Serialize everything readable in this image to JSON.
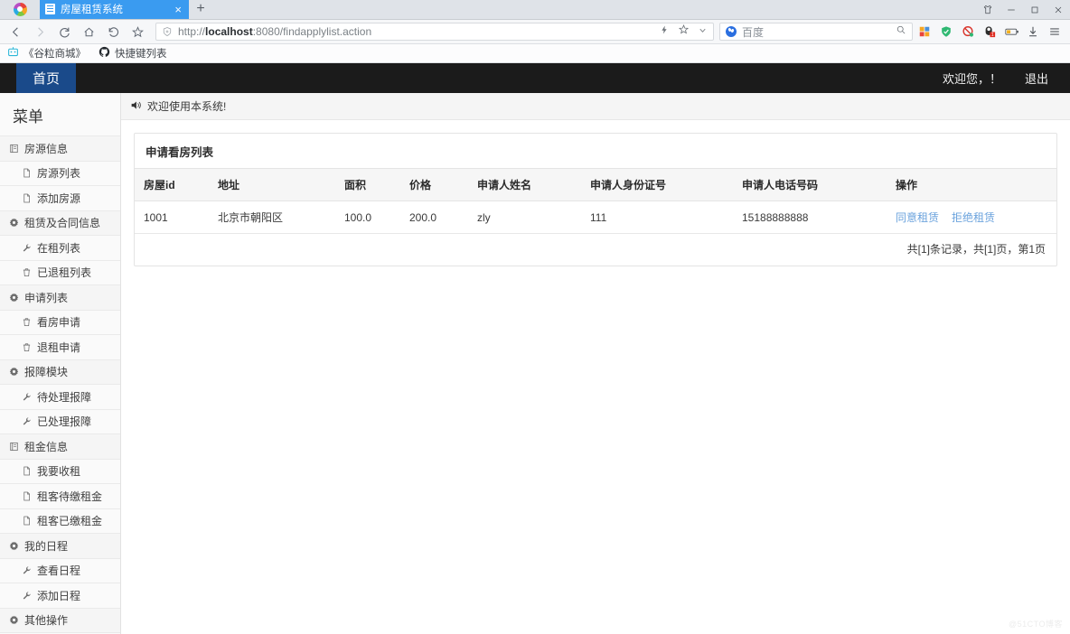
{
  "browser": {
    "tab": {
      "title": "房屋租赁系统",
      "favicon": "page-icon",
      "close": "×"
    },
    "newtab_label": "+",
    "window_controls": [
      "skin-icon",
      "minimize-icon",
      "maximize-icon",
      "close-icon"
    ],
    "nav": {
      "back": "‹",
      "forward": "›",
      "reload": "⟳",
      "home": "⌂",
      "history": "↺",
      "favorite": "☆"
    },
    "url": {
      "scheme": "http://",
      "host": "localhost",
      "rest": ":8080/findapplylist.action",
      "full": "http://localhost:8080/findapplylist.action"
    },
    "url_right_icons": [
      "lightning-icon",
      "star-icon",
      "chevron-down-icon"
    ],
    "search": {
      "engine": "百度",
      "engine_icon": "baidu-icon",
      "placeholder": "百度",
      "value": "",
      "search_icon": "search-icon"
    },
    "extensions": [
      "apps-grid-icon",
      "shield-icon",
      "adblock-icon",
      "mouse-gesture-icon",
      "battery-icon",
      "download-icon",
      "menu-icon"
    ],
    "bookmarks": [
      {
        "label": "《谷粒商城》",
        "icon": "bookmark-site-icon"
      },
      {
        "label": "快捷键列表",
        "icon": "github-icon"
      }
    ]
  },
  "app": {
    "home_tab": "首页",
    "welcome_user": "欢迎您，！",
    "logout": "退出",
    "notice": "欢迎使用本系统!",
    "notice_icon": "speaker-icon",
    "sidebar": {
      "title": "菜单",
      "items": [
        {
          "label": "房源信息",
          "type": "group",
          "icon": "book-icon"
        },
        {
          "label": "房源列表",
          "type": "item",
          "icon": "file-icon"
        },
        {
          "label": "添加房源",
          "type": "item",
          "icon": "file-icon"
        },
        {
          "label": "租赁及合同信息",
          "type": "group",
          "icon": "gear-icon"
        },
        {
          "label": "在租列表",
          "type": "item",
          "icon": "wrench-icon"
        },
        {
          "label": "已退租列表",
          "type": "item",
          "icon": "trash-icon"
        },
        {
          "label": "申请列表",
          "type": "group",
          "icon": "gear-icon"
        },
        {
          "label": "看房申请",
          "type": "item",
          "icon": "trash-icon"
        },
        {
          "label": "退租申请",
          "type": "item",
          "icon": "trash-icon"
        },
        {
          "label": "报障模块",
          "type": "group",
          "icon": "gear-icon"
        },
        {
          "label": "待处理报障",
          "type": "item",
          "icon": "wrench-icon"
        },
        {
          "label": "已处理报障",
          "type": "item",
          "icon": "wrench-icon"
        },
        {
          "label": "租金信息",
          "type": "group",
          "icon": "book-icon"
        },
        {
          "label": "我要收租",
          "type": "item",
          "icon": "file-icon"
        },
        {
          "label": "租客待缴租金",
          "type": "item",
          "icon": "file-icon"
        },
        {
          "label": "租客已缴租金",
          "type": "item",
          "icon": "file-icon"
        },
        {
          "label": "我的日程",
          "type": "group",
          "icon": "gear-icon"
        },
        {
          "label": "查看日程",
          "type": "item",
          "icon": "wrench-icon"
        },
        {
          "label": "添加日程",
          "type": "item",
          "icon": "wrench-icon"
        },
        {
          "label": "其他操作",
          "type": "group",
          "icon": "gear-icon"
        }
      ]
    },
    "panel": {
      "title": "申请看房列表",
      "columns": [
        "房屋id",
        "地址",
        "面积",
        "价格",
        "申请人姓名",
        "申请人身份证号",
        "申请人电话号码",
        "操作"
      ],
      "rows": [
        {
          "house_id": "1001",
          "address": "北京市朝阳区",
          "area": "100.0",
          "price": "200.0",
          "applicant_name": "zly",
          "applicant_id": "111",
          "applicant_phone": "15188888888",
          "action_accept": "同意租赁",
          "action_reject": "拒绝租赁"
        }
      ],
      "pager": "共[1]条记录，共[1]页，第1页"
    },
    "watermark": "@51CTO博客"
  },
  "colors": {
    "navbar_bg": "#1b1b1b",
    "home_tab_bg": "#1a4a8a",
    "tab_active_bg": "#3a9bf0",
    "link": "#6ba3dd",
    "sidebar_bg": "#fafafa"
  }
}
